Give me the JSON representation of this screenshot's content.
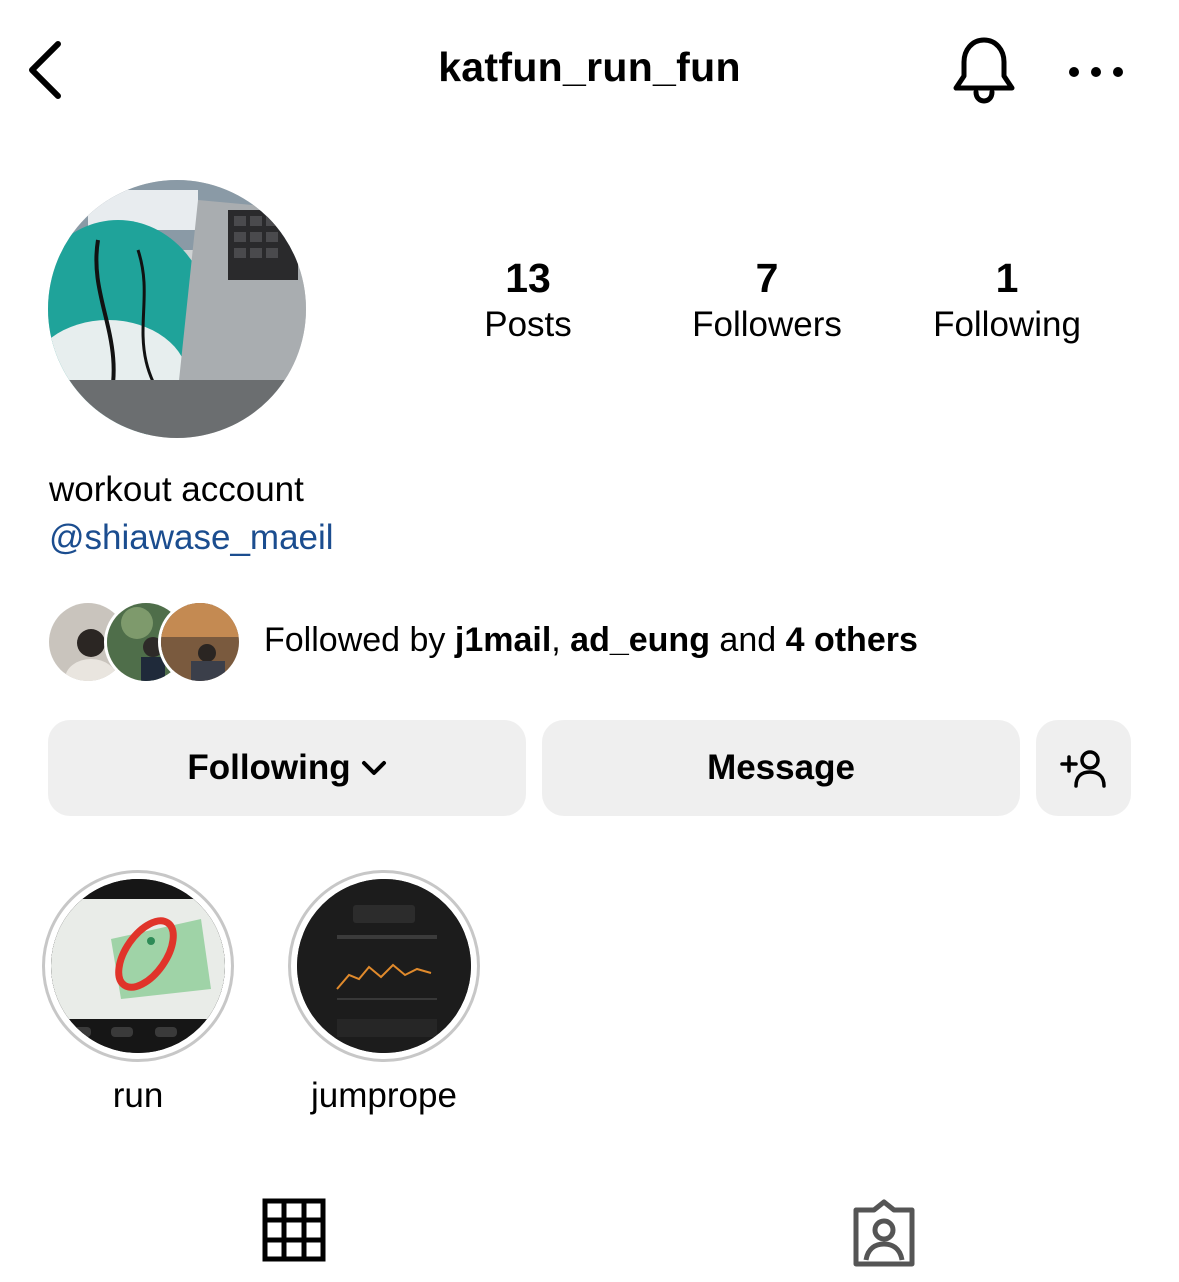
{
  "header": {
    "username": "katfun_run_fun",
    "back_icon": "chevron-left-icon",
    "bell_icon": "bell-icon",
    "more_icon": "more-horizontal-icon"
  },
  "profile": {
    "stats": [
      {
        "value": "13",
        "label": "Posts"
      },
      {
        "value": "7",
        "label": "Followers"
      },
      {
        "value": "1",
        "label": "Following"
      }
    ],
    "bio": "workout account",
    "mention": "@shiawase_maeil"
  },
  "followed_by": {
    "prefix": "Followed by ",
    "user1": "j1mail",
    "sep": ", ",
    "user2": "ad_eung",
    "and": " and ",
    "others": "4 others"
  },
  "actions": {
    "following_label": "Following",
    "message_label": "Message",
    "add_person_icon": "add-person-icon"
  },
  "highlights": [
    {
      "label": "run"
    },
    {
      "label": "jumprope"
    }
  ],
  "tabs": {
    "grid_icon": "grid-icon",
    "tagged_icon": "tagged-person-icon"
  },
  "colors": {
    "link": "#1b4d8f",
    "button_bg": "#efefef",
    "ring": "#c7c7c7"
  }
}
